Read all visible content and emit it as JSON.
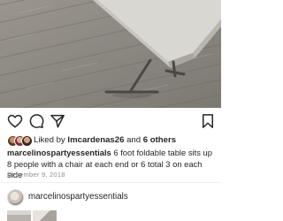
{
  "post": {
    "image_icon": "post-photo-folding-table-icon",
    "actions": {
      "like_icon": "heart-icon",
      "comment_icon": "comment-icon",
      "share_icon": "paper-plane-icon",
      "save_icon": "bookmark-icon"
    },
    "likes": {
      "prefix": "Liked by ",
      "user": "lmcardenas26",
      "middle": " and ",
      "others": "6 others"
    },
    "caption": {
      "username": "marcelinospartyessentials",
      "text": " 6 foot foldable table sits up 8 people with a chair at each end or 6 total 3 on each side"
    },
    "date": "December 9, 2018"
  },
  "more_from": {
    "username": "marcelinospartyessentials"
  },
  "colors": {
    "text": "#262626",
    "muted": "#8e8e8e",
    "divider": "#efefef"
  }
}
